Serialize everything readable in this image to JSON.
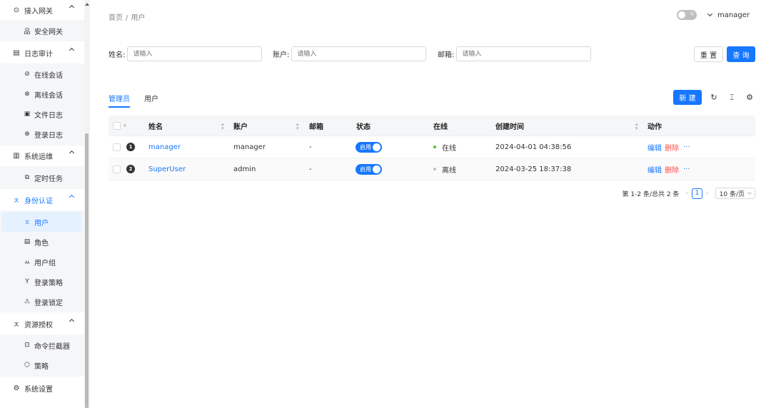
{
  "sidebar": {
    "groups": [
      {
        "label": "接入网关",
        "icon": "eye-icon"
      },
      {
        "label": "日志审计",
        "icon": "audit-icon"
      },
      {
        "label": "系统运维",
        "icon": "ops-icon"
      },
      {
        "label": "身份认证",
        "icon": "user-icon"
      },
      {
        "label": "资源授权",
        "icon": "user-icon"
      },
      {
        "label": "系统设置",
        "icon": "gear-icon"
      }
    ],
    "items": [
      {
        "label": "安全网关",
        "icon": "gateway-icon"
      },
      {
        "label": "在线会话",
        "icon": "link-icon"
      },
      {
        "label": "离线会话",
        "icon": "unlink-icon"
      },
      {
        "label": "文件日志",
        "icon": "file-icon"
      },
      {
        "label": "登录日志",
        "icon": "login-icon"
      },
      {
        "label": "定时任务",
        "icon": "task-icon"
      },
      {
        "label": "用户",
        "icon": "user-icon"
      },
      {
        "label": "角色",
        "icon": "role-icon"
      },
      {
        "label": "用户组",
        "icon": "group-icon"
      },
      {
        "label": "登录策略",
        "icon": "strategy-icon"
      },
      {
        "label": "登录锁定",
        "icon": "warning-icon"
      },
      {
        "label": "命令拦截器",
        "icon": "terminal-icon"
      },
      {
        "label": "策略",
        "icon": "shield-icon"
      }
    ]
  },
  "header": {
    "breadcrumb": [
      "首页",
      "用户"
    ],
    "breadcrumb_sep": "/",
    "username": "manager"
  },
  "search": {
    "fields": [
      {
        "label": "姓名:",
        "placeholder": "请输入"
      },
      {
        "label": "账户:",
        "placeholder": "请输入"
      },
      {
        "label": "邮箱:",
        "placeholder": "请输入"
      }
    ],
    "reset_label": "重 置",
    "search_label": "查 询"
  },
  "tabs": [
    "管理员",
    "用户"
  ],
  "toolbar": {
    "new_label": "新 建"
  },
  "table": {
    "columns": [
      "姓名",
      "账户",
      "邮箱",
      "状态",
      "在线",
      "创建时间",
      "动作"
    ],
    "rows": [
      {
        "index": "1",
        "name": "manager",
        "account": "manager",
        "email": "-",
        "status": "启用",
        "online": "在线",
        "online_color": "#52c41a",
        "created": "2024-04-01 04:38:56",
        "edit": "编辑",
        "delete": "删除",
        "more": "···"
      },
      {
        "index": "2",
        "name": "SuperUser",
        "account": "admin",
        "email": "-",
        "status": "启用",
        "online": "离线",
        "online_color": "#bfbfbf",
        "created": "2024-03-25 18:37:38",
        "edit": "编辑",
        "delete": "删除",
        "more": "···"
      }
    ]
  },
  "pagination": {
    "summary": "第 1-2 条/总共 2 条",
    "current": "1",
    "page_size": "10 条/页"
  },
  "colors": {
    "primary": "#1677ff",
    "danger": "#ff4d4f",
    "online": "#52c41a"
  }
}
